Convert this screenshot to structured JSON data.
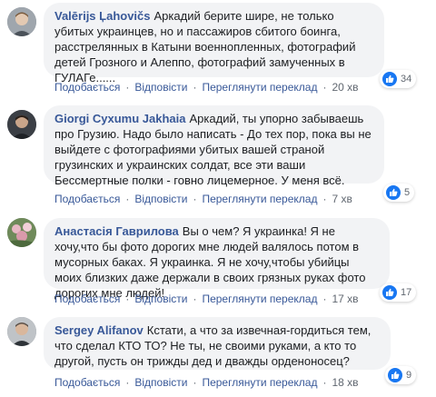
{
  "comments": [
    {
      "author": "Valērijs Ļahovičs",
      "text": "Аркадий берите шире, не только убитых украинцев, но и пассажиров сбитого боинга, расстрелянных в Катыни военнопленных, фотографий детей Грозного и Алеппо, фотографий замученных в ГУЛАГе......",
      "like": "Подобається",
      "reply": "Відповісти",
      "translate": "Переглянути переклад",
      "time": "20 хв",
      "reactions": "34"
    },
    {
      "author": "Giorgi Cyxumu Jakhaia",
      "text": "Аркадий, ты упорно забываешь про Грузию. Надо было написать - До тех пор, пока вы не выйдете с фотографиями убитых вашей страной грузинских и украинских солдат, все эти ваши Бессмертные полки - говно лицемерное. У меня всё.",
      "like": "Подобається",
      "reply": "Відповісти",
      "translate": "Переглянути переклад",
      "time": "7 хв",
      "reactions": "5"
    },
    {
      "author": "Анастасія Гаврилова",
      "text": "Вы о чем? Я украинка! Я не хочу,что бы фото дорогих мне людей валялось потом в мусорных баках. Я украинка. Я не хочу,чтобы убийцы моих близких даже держали в своих грязных руках фото дорогих мне людей!",
      "like": "Подобається",
      "reply": "Відповісти",
      "translate": "Переглянути переклад",
      "time": "17 хв",
      "reactions": "17"
    },
    {
      "author": "Sergey Alifanov",
      "text": "Кстати, а что за извечная-гордиться тем, что сделал КТО ТО? Не ты, не своими руками, а кто то другой, пусть он трижды дед и дважды орденоносец?",
      "like": "Подобається",
      "reply": "Відповісти",
      "translate": "Переглянути переклад",
      "time": "18 хв",
      "reactions": "9"
    }
  ],
  "colors": {
    "link": "#385898",
    "bubble": "#f2f3f5",
    "like_badge": "#1877f2"
  }
}
